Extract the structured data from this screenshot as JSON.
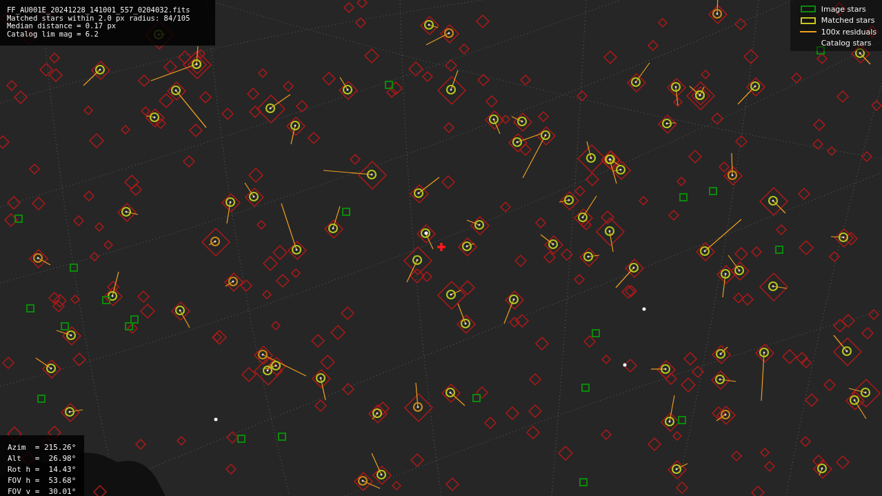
{
  "info_panel": {
    "lines": [
      "FF_AU001E_20241228_141001_557_0204032.fits",
      "Matched stars within 2.0 px radius: 84/105",
      "Median distance = 0.17 px",
      "Catalog lim mag = 6.2"
    ]
  },
  "legend": [
    {
      "kind": "box",
      "label": "Image stars",
      "color": "#0a8a0a"
    },
    {
      "kind": "box",
      "label": "Matched stars",
      "color": "#c8c81e"
    },
    {
      "kind": "line",
      "label": "100x residuals",
      "color": "#f0a020"
    },
    {
      "kind": "none",
      "label": "Catalog stars"
    }
  ],
  "pointing_panel": {
    "lines": [
      "Azim  = 215.26°",
      "Alt   =  26.98°",
      "Rot h =  14.43°",
      "FOV h =  53.68°",
      "FOV v =  30.01°"
    ]
  }
}
